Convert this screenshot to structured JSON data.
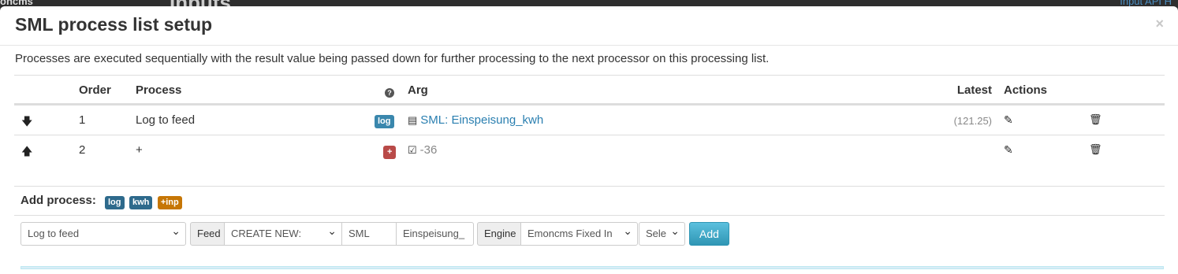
{
  "background": {
    "left_text": "oncms",
    "inputs_title": "Inputs",
    "api_link": "Input API H"
  },
  "modal": {
    "title": "SML process list setup",
    "close": "×",
    "description": "Processes are executed sequentially with the result value being passed down for further processing to the next processor on this processing list."
  },
  "table": {
    "headers": {
      "order": "Order",
      "process": "Process",
      "help": "?",
      "arg": "Arg",
      "latest": "Latest",
      "actions": "Actions"
    },
    "rows": [
      {
        "order": "1",
        "process": "Log to feed",
        "badge": "log",
        "arg_text": "SML: Einspeisung_kwh",
        "latest": "(121.25)"
      },
      {
        "order": "2",
        "process": "+",
        "badge": "+",
        "arg_text": "-36",
        "latest": ""
      }
    ]
  },
  "add_process": {
    "label": "Add process:",
    "badges": [
      "log",
      "kwh",
      "+inp"
    ]
  },
  "controls": {
    "process_select": "Log to feed",
    "feed_label": "Feed",
    "feed_select": "CREATE NEW:",
    "tag_value": "SML",
    "name_value": "Einspeisung_",
    "engine_label": "Engine",
    "engine_select": "Emoncms Fixed In",
    "interval_select": "Sele",
    "add_button": "Add"
  },
  "colors": {
    "link": "#2a7fb0",
    "badge_log": "#3a87ad",
    "badge_red": "#b94a48",
    "badge_orange": "#c67605",
    "button_info": "#5bc0de"
  }
}
